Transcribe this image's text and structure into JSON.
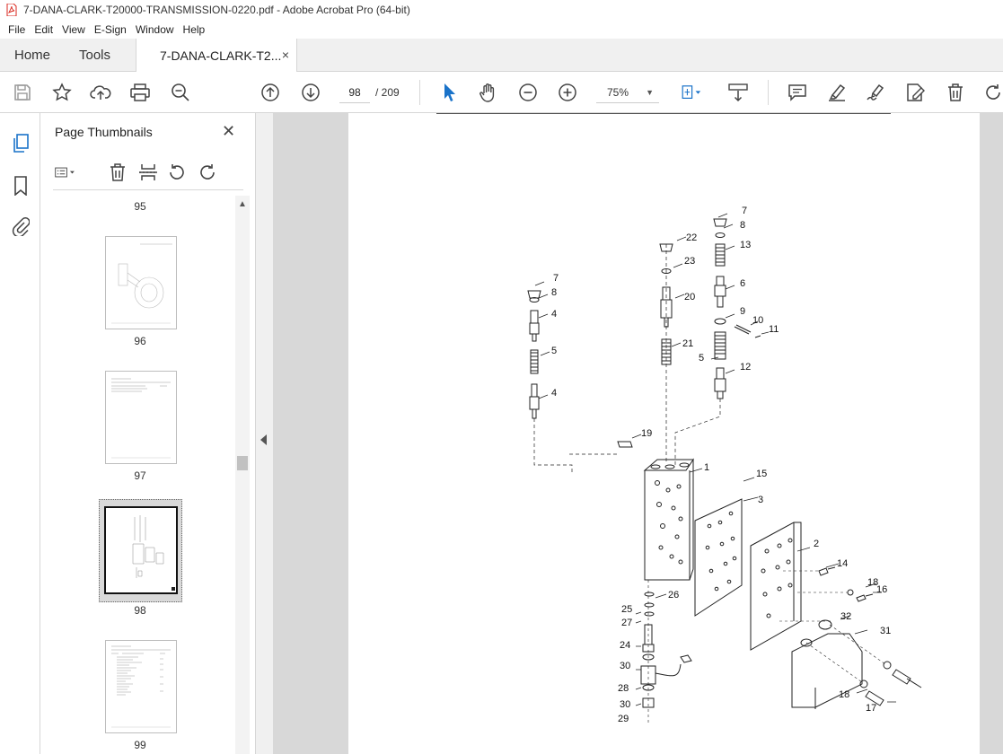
{
  "window": {
    "title": "7-DANA-CLARK-T20000-TRANSMISSION-0220.pdf - Adobe Acrobat Pro (64-bit)"
  },
  "menu": [
    "File",
    "Edit",
    "View",
    "E-Sign",
    "Window",
    "Help"
  ],
  "tabs": {
    "home": "Home",
    "tools": "Tools",
    "document": "7-DANA-CLARK-T2...",
    "close": "×"
  },
  "toolbar": {
    "current_page": "98",
    "total_pages": "/ 209",
    "zoom": "75%"
  },
  "panel": {
    "title": "Page Thumbnails",
    "close": "✕",
    "thumbnails": [
      {
        "label": "95"
      },
      {
        "label": "96"
      },
      {
        "label": "97"
      },
      {
        "label": "98",
        "selected": true
      },
      {
        "label": "99"
      }
    ]
  },
  "diagram": {
    "callouts": [
      "7",
      "8",
      "22",
      "23",
      "13",
      "7",
      "8",
      "20",
      "6",
      "4",
      "9",
      "10",
      "11",
      "21",
      "5",
      "5",
      "12",
      "4",
      "19",
      "1",
      "15",
      "3",
      "2",
      "14",
      "18",
      "16",
      "26",
      "25",
      "27",
      "32",
      "31",
      "24",
      "30",
      "28",
      "30",
      "29",
      "18",
      "17"
    ]
  }
}
